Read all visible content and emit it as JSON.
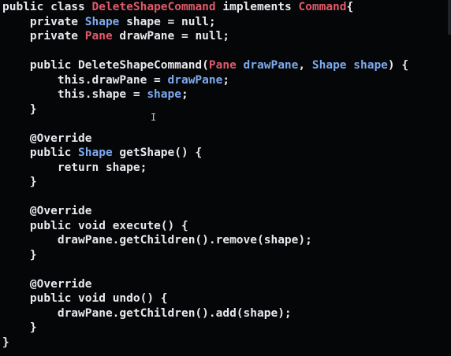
{
  "editor": {
    "lines": [
      [
        {
          "c": "kw",
          "t": "public class "
        },
        {
          "c": "type-red",
          "t": "DeleteShapeCommand"
        },
        {
          "c": "kw",
          "t": " implements "
        },
        {
          "c": "type-red",
          "t": "Command"
        },
        {
          "c": "plain",
          "t": "{"
        }
      ],
      [
        {
          "c": "kw",
          "t": "    private "
        },
        {
          "c": "type-blue",
          "t": "Shape"
        },
        {
          "c": "plain",
          "t": " shape = null;"
        }
      ],
      [
        {
          "c": "kw",
          "t": "    private "
        },
        {
          "c": "type-red",
          "t": "Pane"
        },
        {
          "c": "plain",
          "t": " drawPane = null;"
        }
      ],
      [
        {
          "c": "plain",
          "t": ""
        }
      ],
      [
        {
          "c": "kw",
          "t": "    public "
        },
        {
          "c": "plain",
          "t": "DeleteShapeCommand("
        },
        {
          "c": "type-red",
          "t": "Pane"
        },
        {
          "c": "param",
          "t": " drawPane"
        },
        {
          "c": "plain",
          "t": ", "
        },
        {
          "c": "type-blue",
          "t": "Shape"
        },
        {
          "c": "param",
          "t": " shape"
        },
        {
          "c": "plain",
          "t": ") {"
        }
      ],
      [
        {
          "c": "plain",
          "t": "        this.drawPane = "
        },
        {
          "c": "param",
          "t": "drawPane"
        },
        {
          "c": "plain",
          "t": ";"
        }
      ],
      [
        {
          "c": "plain",
          "t": "        this.shape = "
        },
        {
          "c": "param",
          "t": "shape"
        },
        {
          "c": "plain",
          "t": ";"
        }
      ],
      [
        {
          "c": "plain",
          "t": "    }"
        }
      ],
      [
        {
          "c": "plain",
          "t": ""
        }
      ],
      [
        {
          "c": "annot",
          "t": "    @Override"
        }
      ],
      [
        {
          "c": "kw",
          "t": "    public "
        },
        {
          "c": "type-blue",
          "t": "Shape"
        },
        {
          "c": "plain",
          "t": " getShape() {"
        }
      ],
      [
        {
          "c": "plain",
          "t": "        return shape;"
        }
      ],
      [
        {
          "c": "plain",
          "t": "    }"
        }
      ],
      [
        {
          "c": "plain",
          "t": ""
        }
      ],
      [
        {
          "c": "annot",
          "t": "    @Override"
        }
      ],
      [
        {
          "c": "kw",
          "t": "    public void "
        },
        {
          "c": "plain",
          "t": "execute() {"
        }
      ],
      [
        {
          "c": "plain",
          "t": "        drawPane.getChildren().remove(shape);"
        }
      ],
      [
        {
          "c": "plain",
          "t": "    }"
        }
      ],
      [
        {
          "c": "plain",
          "t": ""
        }
      ],
      [
        {
          "c": "annot",
          "t": "    @Override"
        }
      ],
      [
        {
          "c": "kw",
          "t": "    public void "
        },
        {
          "c": "plain",
          "t": "undo() {"
        }
      ],
      [
        {
          "c": "plain",
          "t": "        drawPane.getChildren().add(shape);"
        }
      ],
      [
        {
          "c": "plain",
          "t": "    }"
        }
      ],
      [
        {
          "c": "plain",
          "t": "}"
        }
      ]
    ],
    "cursor_glyph": "I"
  },
  "colors": {
    "background": "#050607",
    "keyword": "#e7e9ee",
    "type_red": "#e05a6a",
    "type_blue": "#7eaaf0"
  }
}
